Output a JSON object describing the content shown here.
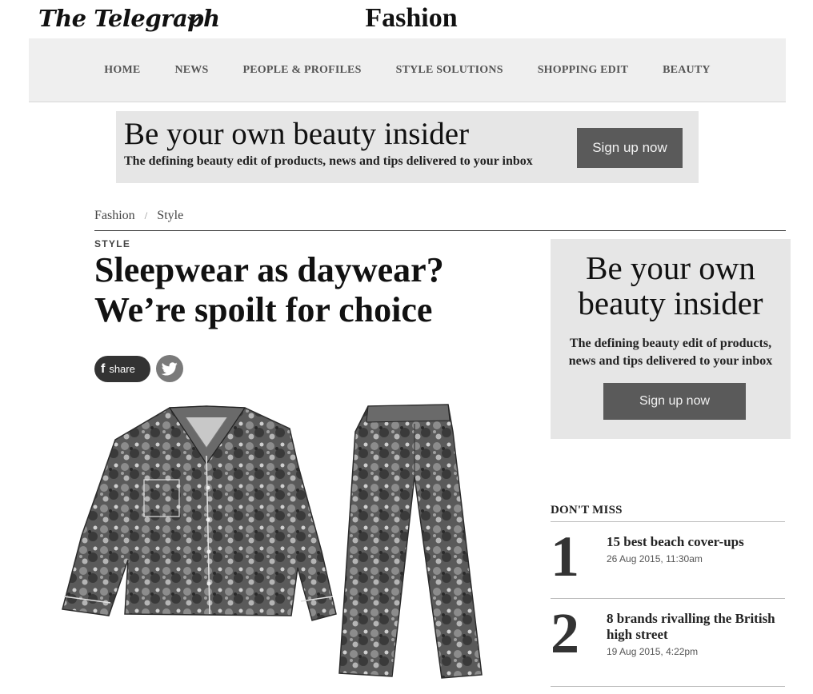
{
  "header": {
    "brand": "The Telegraph",
    "section_title": "Fashion"
  },
  "nav": {
    "items": [
      "HOME",
      "NEWS",
      "PEOPLE & PROFILES",
      "STYLE SOLUTIONS",
      "SHOPPING EDIT",
      "BEAUTY"
    ]
  },
  "banner_top": {
    "headline": "Be your own beauty insider",
    "sub": "The defining beauty edit of products, news and tips delivered to your inbox",
    "cta": "Sign up now"
  },
  "breadcrumb": {
    "items": [
      "Fashion",
      "Style"
    ],
    "separator": "/"
  },
  "article": {
    "kicker": "STYLE",
    "headline_line1": "Sleepwear as daywear?",
    "headline_line2": "We’re spoilt for choice",
    "share_label": "share"
  },
  "ad_side": {
    "headline_line1": "Be your own",
    "headline_line2": "beauty insider",
    "sub_line1": "The defining beauty edit of products,",
    "sub_line2": "news and tips delivered to your inbox",
    "cta": "Sign up now"
  },
  "dont_miss": {
    "title": "DON'T MISS",
    "items": [
      {
        "number": "1",
        "title": "15 best beach cover-ups",
        "date": "26 Aug 2015, 11:30am"
      },
      {
        "number": "2",
        "title": "8 brands rivalling the British high street",
        "date": "19 Aug 2015, 4:22pm"
      }
    ]
  },
  "icons": {
    "logo_chevron": "chevron-down-icon",
    "facebook": "facebook-icon",
    "twitter": "twitter-icon"
  }
}
